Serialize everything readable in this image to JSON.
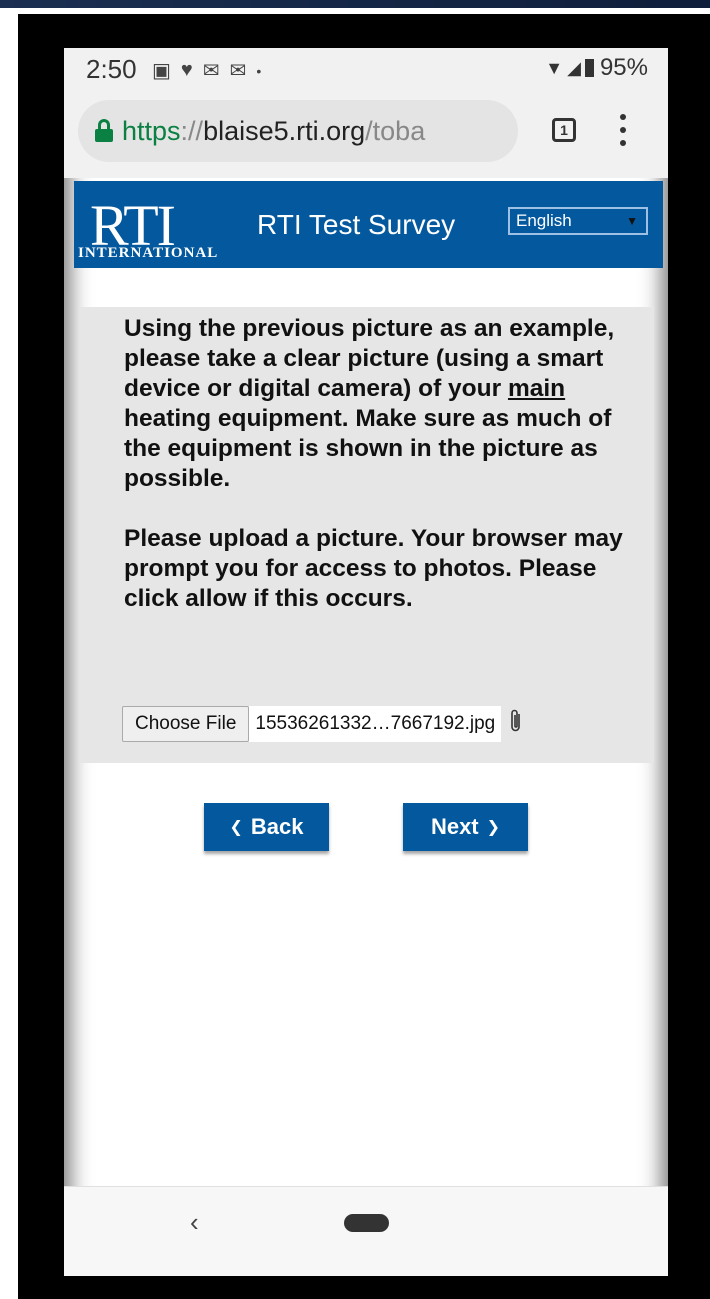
{
  "status_bar": {
    "time": "2:50",
    "battery": "95%",
    "icons_left": [
      "image-icon",
      "heart-icon",
      "gmail-icon",
      "mail-icon",
      "dot-icon"
    ],
    "icons_right": [
      "wifi-icon",
      "signal-icon",
      "battery-icon"
    ]
  },
  "browser": {
    "url_scheme": "https",
    "url_sep": "://",
    "url_host": "blaise5.rti.org",
    "url_path": "/toba",
    "tab_count": "1"
  },
  "header": {
    "logo_mark": "RTI",
    "logo_sub": "INTERNATIONAL",
    "title": "RTI Test Survey",
    "language": "English"
  },
  "question": {
    "part1_before": "Using the previous picture as an example, please take a clear picture (using a smart device or digital camera) of your ",
    "part1_underlined": "main",
    "part1_after": " heating equipment. Make sure as much of the equipment is shown in the picture as possible.",
    "part2": "Please upload a picture. Your browser may prompt you for access to photos. Please click allow if this occurs."
  },
  "file_input": {
    "button_label": "Choose File",
    "file_name": "15536261332…7667192.jpg"
  },
  "nav": {
    "back_label": "Back",
    "next_label": "Next",
    "back_chevron": "❮",
    "next_chevron": "❯"
  },
  "android": {
    "back_glyph": "‹"
  }
}
